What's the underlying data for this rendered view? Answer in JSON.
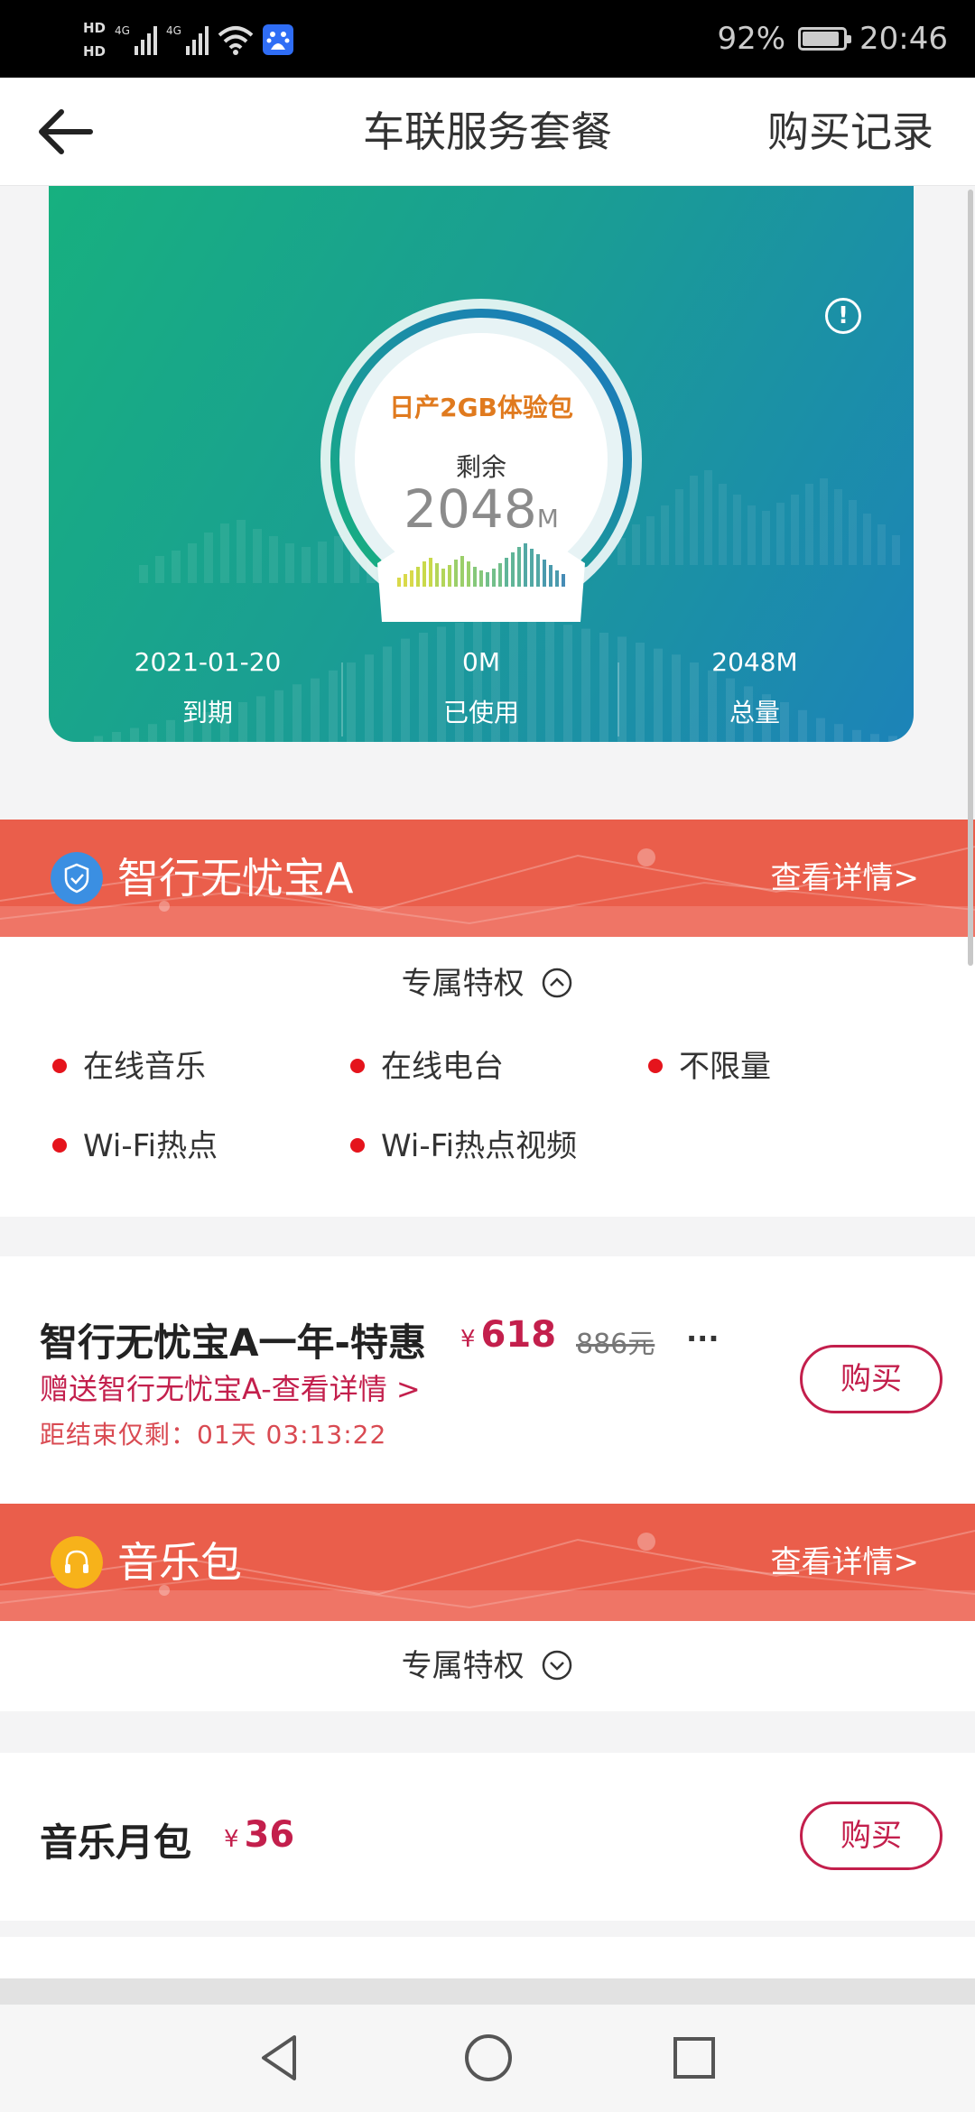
{
  "status_bar": {
    "hd1": "HD",
    "hd2": "HD",
    "sig1": "4G",
    "sig2": "4G",
    "battery": "92%",
    "battery_level": 0.92,
    "time": "20:46"
  },
  "nav": {
    "title": "车联服务套餐",
    "right": "购买记录"
  },
  "data_card": {
    "package_name": "日产2GB体验包",
    "remaining_label": "剩余",
    "remaining_value": "2048",
    "remaining_unit": "M",
    "remaining_fraction": 1.0,
    "stats": [
      {
        "value": "2021-01-20",
        "label": "到期"
      },
      {
        "value": "0M",
        "label": "已使用"
      },
      {
        "value": "2048M",
        "label": "总量"
      }
    ]
  },
  "packages": [
    {
      "title": "智行无忧宝A",
      "link": "查看详情>",
      "icon": "shield-icon",
      "icon_color": "#3b8fe2",
      "privilege_title": "专属特权",
      "expanded": true,
      "perks": [
        "在线音乐",
        "在线电台",
        "不限量",
        "Wi-Fi热点",
        "Wi-Fi热点视频"
      ],
      "offer": {
        "name": "智行无忧宝A一年-特惠",
        "currency": "¥",
        "price": "618",
        "original": "886元",
        "more": "...",
        "gift": "赠送智行无忧宝A-查看详情 >",
        "countdown": "距结束仅剩：01天 03:13:22",
        "buy": "购买"
      }
    },
    {
      "title": "音乐包",
      "link": "查看详情>",
      "icon": "headphones-icon",
      "icon_color": "#f7b21a",
      "privilege_title": "专属特权",
      "expanded": false,
      "offer": {
        "name": "音乐月包",
        "currency": "¥",
        "price": "36",
        "buy": "购买"
      }
    }
  ],
  "colors": {
    "banner": "#ea5e4b",
    "accent": "#c31f4c",
    "dot": "#e5141c",
    "card_start": "#17b07f",
    "card_end": "#1c83b8"
  }
}
